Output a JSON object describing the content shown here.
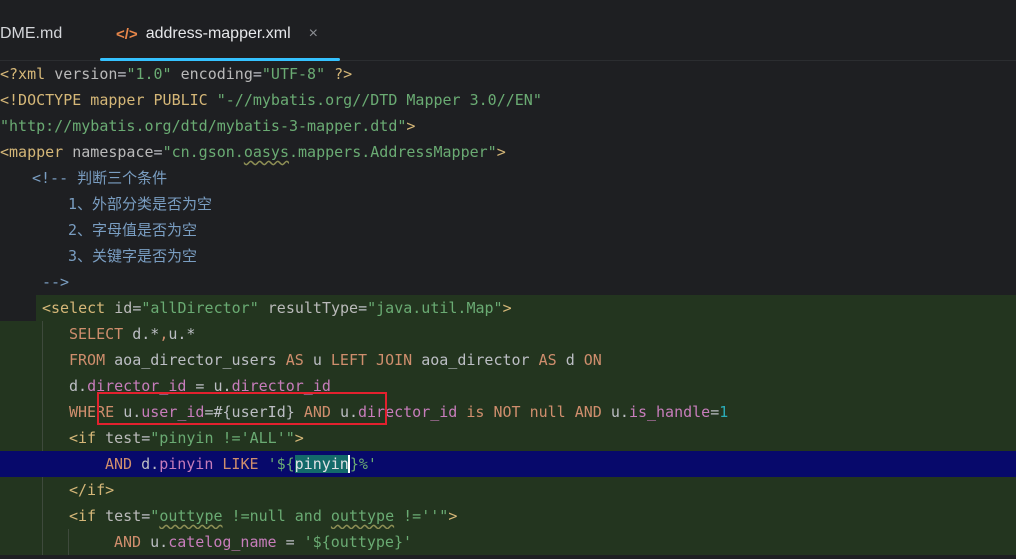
{
  "tabs": {
    "readme_label": "DME.md",
    "active_icon": "</>",
    "active_label": "address-mapper.xml",
    "close_glyph": "×"
  },
  "code": {
    "l1": {
      "a": "<?xml ",
      "b": "version",
      "c": "=",
      "d": "\"1.0\"",
      "e": " encoding",
      "f": "=",
      "g": "\"UTF-8\"",
      "h": " ?>"
    },
    "l2": {
      "a": "<!DOCTYPE mapper PUBLIC ",
      "b": "\"-//mybatis.org//DTD Mapper 3.0//EN\""
    },
    "l3": {
      "a": "\"http://mybatis.org/dtd/mybatis-3-mapper.dtd\"",
      "b": ">"
    },
    "l4": {
      "a": "<mapper ",
      "b": "namespace",
      "c": "=",
      "d": "\"cn.gson.",
      "e": "oasys",
      "f": ".mappers.AddressMapper\"",
      "g": ">"
    },
    "l5": "<!-- 判断三个条件",
    "l6": "1、外部分类是否为空",
    "l7": "2、字母值是否为空",
    "l8": "3、关键字是否为空",
    "l9": "-->",
    "l10": {
      "a": "<select ",
      "b": "id",
      "c": "=",
      "d": "\"allDirector\"",
      "e": " resultType",
      "f": "=",
      "g": "\"java.util.Map\"",
      "h": ">"
    },
    "l11": {
      "a": "SELECT ",
      "b": "d.*",
      "c": ",",
      "d": "u.*"
    },
    "l12": {
      "a": "FROM ",
      "b": "aoa_director_users ",
      "c": "AS ",
      "d": "u ",
      "e": "LEFT JOIN ",
      "f": "aoa_director ",
      "g": "AS ",
      "h": "d ",
      "i": "ON"
    },
    "l13": {
      "a": "d.",
      "b": "director_id",
      "c": " = ",
      "d": "u.",
      "e": "director_id"
    },
    "l14": {
      "a": "WHERE ",
      "b": "u.",
      "c": "user_id",
      "d": "=#{userId} ",
      "e": "AND ",
      "f": "u.",
      "g": "director_id ",
      "h": "is NOT null AND ",
      "i": "u.",
      "j": "is_handle",
      "k": "=",
      "l": "1"
    },
    "l15": {
      "a": "<if ",
      "b": "test",
      "c": "=",
      "d": "\"pinyin !='ALL'\"",
      "e": ">"
    },
    "l16": {
      "a": "AND ",
      "b": "d.",
      "c": "pinyin ",
      "d": "LIKE ",
      "e": "'${",
      "f": "pinyin",
      "g": "}%'"
    },
    "l17": "</if>",
    "l18": {
      "a": "<if ",
      "b": "test",
      "c": "=",
      "d": "\"",
      "e": "outtype",
      "f": " !=null and ",
      "g": "outtype",
      "h": " !=''\"",
      "i": ">"
    },
    "l19": {
      "a": "AND ",
      "b": "u.",
      "c": "catelog_name",
      "d": " = ",
      "e": "'${outtype}'"
    }
  },
  "colors": {
    "selection": "#07096b",
    "sql_block": "#23351f",
    "highlight_box": "#e3212e",
    "tab_underline": "#35c2ff"
  }
}
